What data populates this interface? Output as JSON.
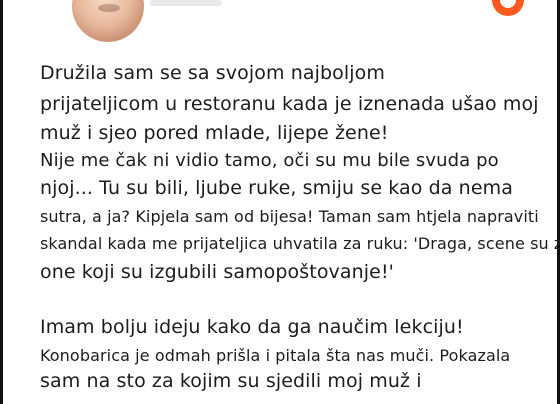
{
  "post": {
    "paragraph1": [
      "Družila sam se sa svojom najboljom",
      "prijateljicom u restoranu kada je iznenada ušao moj",
      "muž i sjeo pored mlade, lijepe žene!",
      "Nije me čak ni vidio tamo, oči su mu bile svuda po",
      "njoj... Tu su bili, ljube ruke, smiju se kao da nema",
      "sutra, a ja? Kipjela sam od bijesa! Taman sam htjela napraviti",
      "skandal kada me prijateljica uhvatila za ruku: 'Draga, scene su za",
      "one koji su izgubili samopoštovanje!'"
    ],
    "paragraph2": [
      "Imam bolju ideju kako da ga naučim lekciju!",
      "Konobarica je odmah prišla i pitala šta nas muči. Pokazala",
      "sam na sto za kojim su sjedili moj muž i"
    ]
  },
  "icons": {
    "avatar": "profile-photo",
    "brand": "orange-circle-logo-icon"
  },
  "colors": {
    "brand": "#ff5a1f",
    "text": "#1c1c1c",
    "background": "#ffffff"
  }
}
